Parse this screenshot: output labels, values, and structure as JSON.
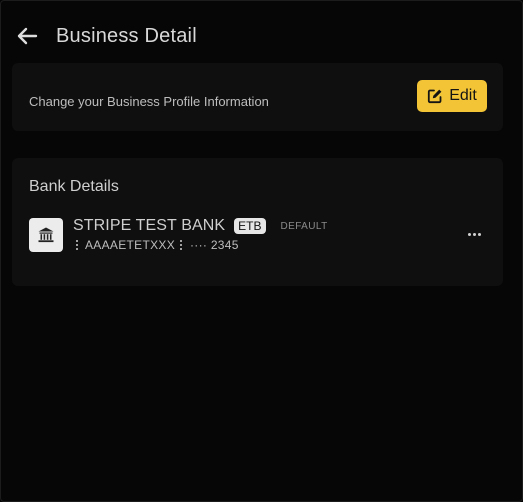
{
  "header": {
    "title": "Business Detail",
    "back_icon": "arrow-left-icon"
  },
  "profile_card": {
    "description": "Change your Business Profile Information",
    "edit_label": "Edit",
    "edit_icon": "pencil-square-icon",
    "accent_color": "#f3c436"
  },
  "bank_section": {
    "heading": "Bank Details",
    "accounts": [
      {
        "icon": "bank-building-icon",
        "name": "STRIPE TEST BANK",
        "currency": "ETB",
        "status": "DEFAULT",
        "code": "AAAAETETXXX",
        "account_masked": "···· 2345",
        "more_icon": "more-horizontal-icon"
      }
    ]
  }
}
